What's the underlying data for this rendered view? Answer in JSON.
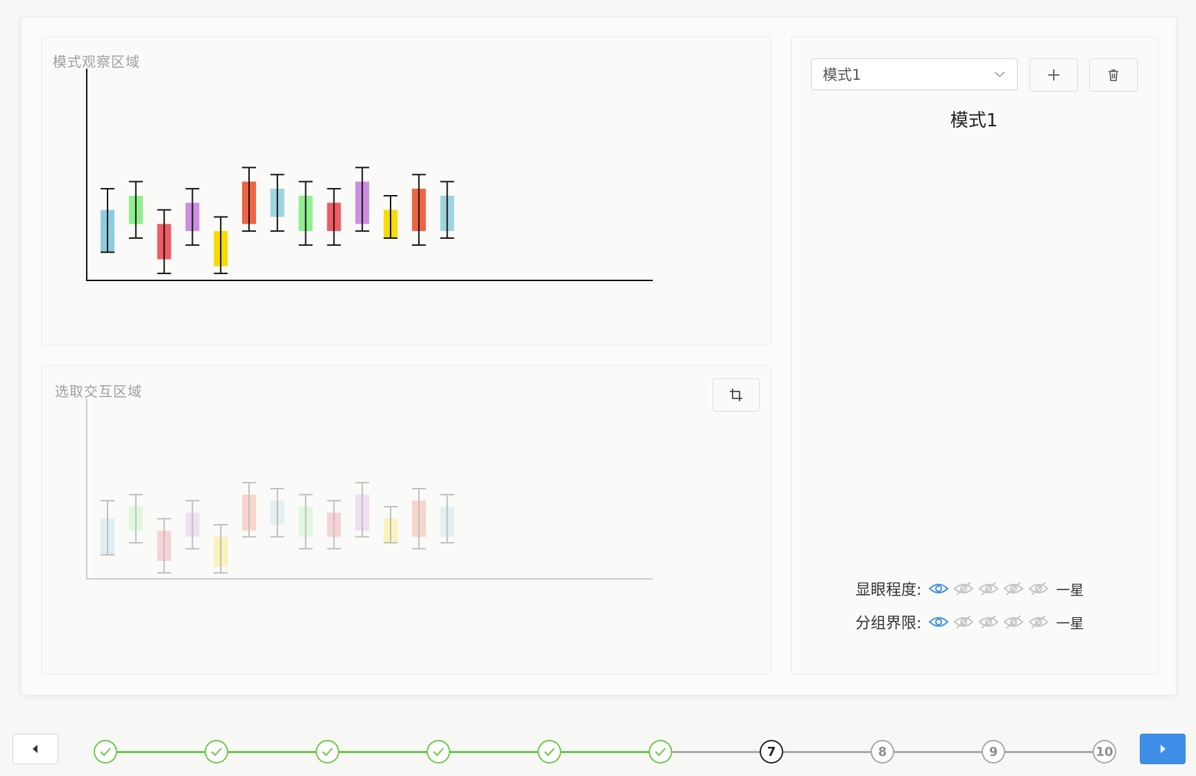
{
  "observe_panel": {
    "title": "模式观察区域"
  },
  "select_panel": {
    "title": "选取交互区域",
    "crop_icon": "crop-icon"
  },
  "mode_panel": {
    "select_value": "模式1",
    "add_icon": "plus-icon",
    "delete_icon": "trash-icon",
    "mode_title": "模式1",
    "ratings": [
      {
        "label": "显眼程度:",
        "level": 1,
        "max": 5,
        "level_text": "一星"
      },
      {
        "label": "分组界限:",
        "level": 1,
        "max": 5,
        "level_text": "一星"
      }
    ]
  },
  "colors": {
    "blue": "#8ecbe0",
    "green": "#8fef8f",
    "red": "#ee5c64",
    "purple": "#cc8ee0",
    "yellow": "#f8dc00",
    "orange": "#ef6444",
    "lightblue": "#9fd4df",
    "accent": "#3f8fe9",
    "done": "#6cc84a"
  },
  "chart_data": [
    {
      "type": "boxplot",
      "title": "",
      "ylim": [
        0,
        30
      ],
      "series": [
        {
          "color": "blue",
          "whisker_low": 4,
          "box_low": 4,
          "box_high": 10,
          "whisker_high": 13
        },
        {
          "color": "green",
          "whisker_low": 6,
          "box_low": 8,
          "box_high": 12,
          "whisker_high": 14
        },
        {
          "color": "red",
          "whisker_low": 1,
          "box_low": 3,
          "box_high": 8,
          "whisker_high": 10
        },
        {
          "color": "purple",
          "whisker_low": 5,
          "box_low": 7,
          "box_high": 11,
          "whisker_high": 13
        },
        {
          "color": "yellow",
          "whisker_low": 1,
          "box_low": 2,
          "box_high": 7,
          "whisker_high": 9
        },
        {
          "color": "orange",
          "whisker_low": 7,
          "box_low": 8,
          "box_high": 14,
          "whisker_high": 16
        },
        {
          "color": "lightblue",
          "whisker_low": 7,
          "box_low": 9,
          "box_high": 13,
          "whisker_high": 15
        },
        {
          "color": "green",
          "whisker_low": 5,
          "box_low": 7,
          "box_high": 12,
          "whisker_high": 14
        },
        {
          "color": "red",
          "whisker_low": 5,
          "box_low": 7,
          "box_high": 11,
          "whisker_high": 13
        },
        {
          "color": "purple",
          "whisker_low": 7,
          "box_low": 8,
          "box_high": 14,
          "whisker_high": 16
        },
        {
          "color": "yellow",
          "whisker_low": 6,
          "box_low": 6,
          "box_high": 10,
          "whisker_high": 12
        },
        {
          "color": "orange",
          "whisker_low": 5,
          "box_low": 7,
          "box_high": 13,
          "whisker_high": 15
        },
        {
          "color": "lightblue",
          "whisker_low": 6,
          "box_low": 7,
          "box_high": 12,
          "whisker_high": 14
        }
      ]
    }
  ],
  "stepper": {
    "steps": [
      {
        "label": "",
        "state": "done"
      },
      {
        "label": "",
        "state": "done"
      },
      {
        "label": "",
        "state": "done"
      },
      {
        "label": "",
        "state": "done"
      },
      {
        "label": "",
        "state": "done"
      },
      {
        "label": "",
        "state": "done"
      },
      {
        "label": "7",
        "state": "current"
      },
      {
        "label": "8",
        "state": "todo"
      },
      {
        "label": "9",
        "state": "todo"
      },
      {
        "label": "10",
        "state": "todo"
      }
    ],
    "prev_icon": "caret-left-icon",
    "next_icon": "caret-right-icon"
  }
}
